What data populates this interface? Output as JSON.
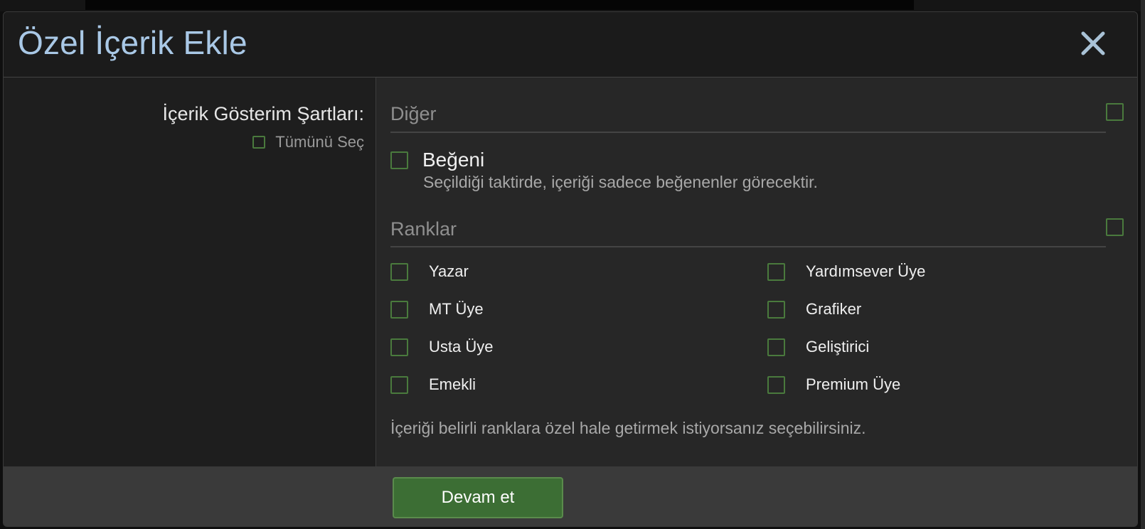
{
  "modal": {
    "title": "Özel İçerik Ekle",
    "close_icon": "close-icon"
  },
  "left": {
    "label": "İçerik Gösterim Şartları:",
    "select_all_label": "Tümünü Seç"
  },
  "sections": {
    "other": {
      "title": "Diğer",
      "like_label": "Beğeni",
      "like_description": "Seçildiği taktirde, içeriği sadece beğenenler görecektir."
    },
    "ranks": {
      "title": "Ranklar",
      "items": [
        "Yazar",
        "MT Üye",
        "Usta Üye",
        "Emekli",
        "Yardımsever Üye",
        "Grafiker",
        "Geliştirici",
        "Premium Üye"
      ],
      "description": "İçeriği belirli ranklara özel hale getirmek istiyorsanız seçebilirsiniz."
    }
  },
  "footer": {
    "continue_label": "Devam et"
  },
  "colors": {
    "title": "#a9c8e6",
    "checkbox_border": "#4a7a3d",
    "button_bg": "#3c6e34"
  }
}
